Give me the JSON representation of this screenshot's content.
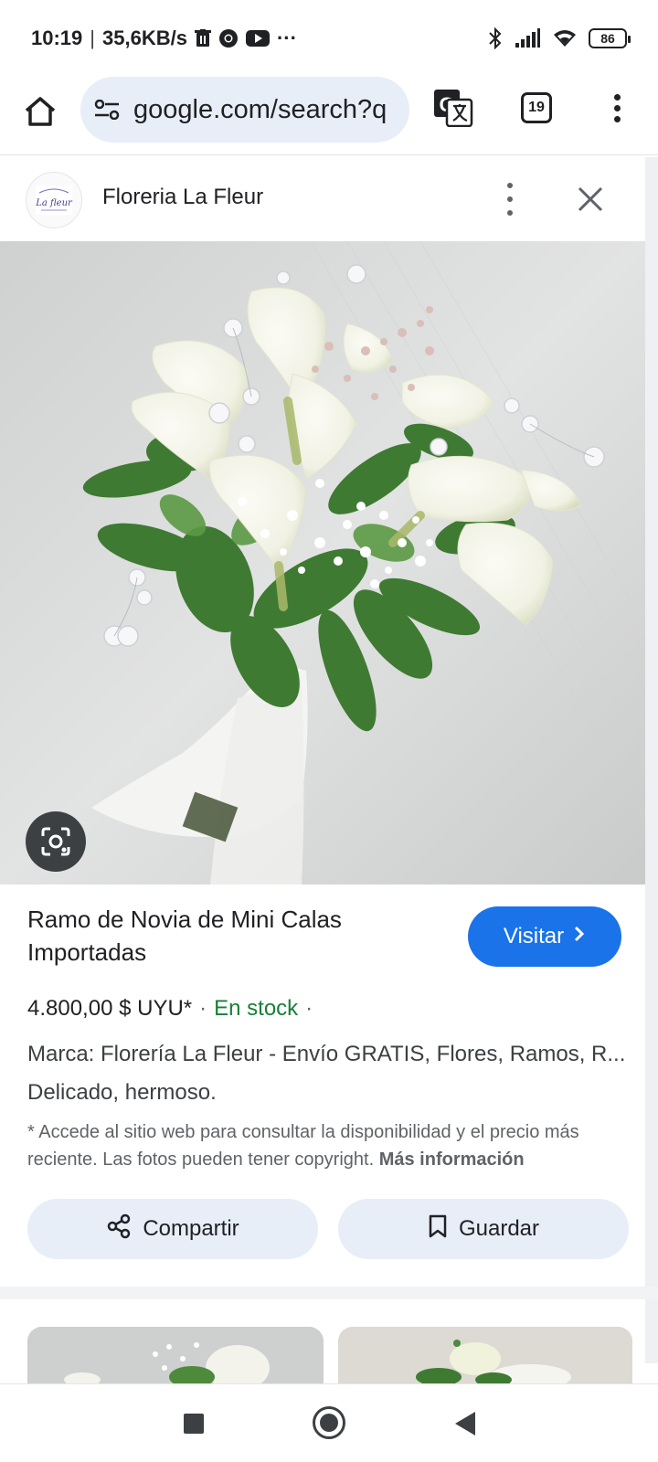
{
  "status_bar": {
    "time": "10:19",
    "separator": "|",
    "network_speed": "35,6KB/s",
    "more": "···",
    "battery": "86"
  },
  "toolbar": {
    "url": "google.com/search?q",
    "tab_count": "19"
  },
  "source": {
    "name": "Floreria La Fleur",
    "logo_text": "La fleur"
  },
  "product": {
    "title": "Ramo de Novia de Mini Calas Importadas",
    "visit_label": "Visitar",
    "price": "4.800,00 $ UYU*",
    "middot": "·",
    "stock": "En stock",
    "middot2": "·",
    "brand_line": "Marca: Florería La Fleur - Envío GRATIS, Flores, Ramos, R...",
    "description": "Delicado, hermoso.",
    "disclaimer": "* Accede al sitio web para consultar la disponibilidad y el precio más reciente. Las fotos pueden tener copyright.",
    "more_info": "Más información"
  },
  "actions": {
    "share_label": "Compartir",
    "save_label": "Guardar"
  },
  "colors": {
    "accent": "#1a73e8",
    "stock": "#188038",
    "button_bg": "#e8eef8"
  },
  "icons": {
    "home": "home-icon",
    "tune": "tune-icon",
    "translate": "translate-icon",
    "tabs": "tab-switcher-icon",
    "menu": "more-vert-icon",
    "close": "close-icon",
    "lens": "lens-icon",
    "share": "share-icon",
    "bookmark": "bookmark-icon",
    "chevron": "chevron-right-icon"
  }
}
